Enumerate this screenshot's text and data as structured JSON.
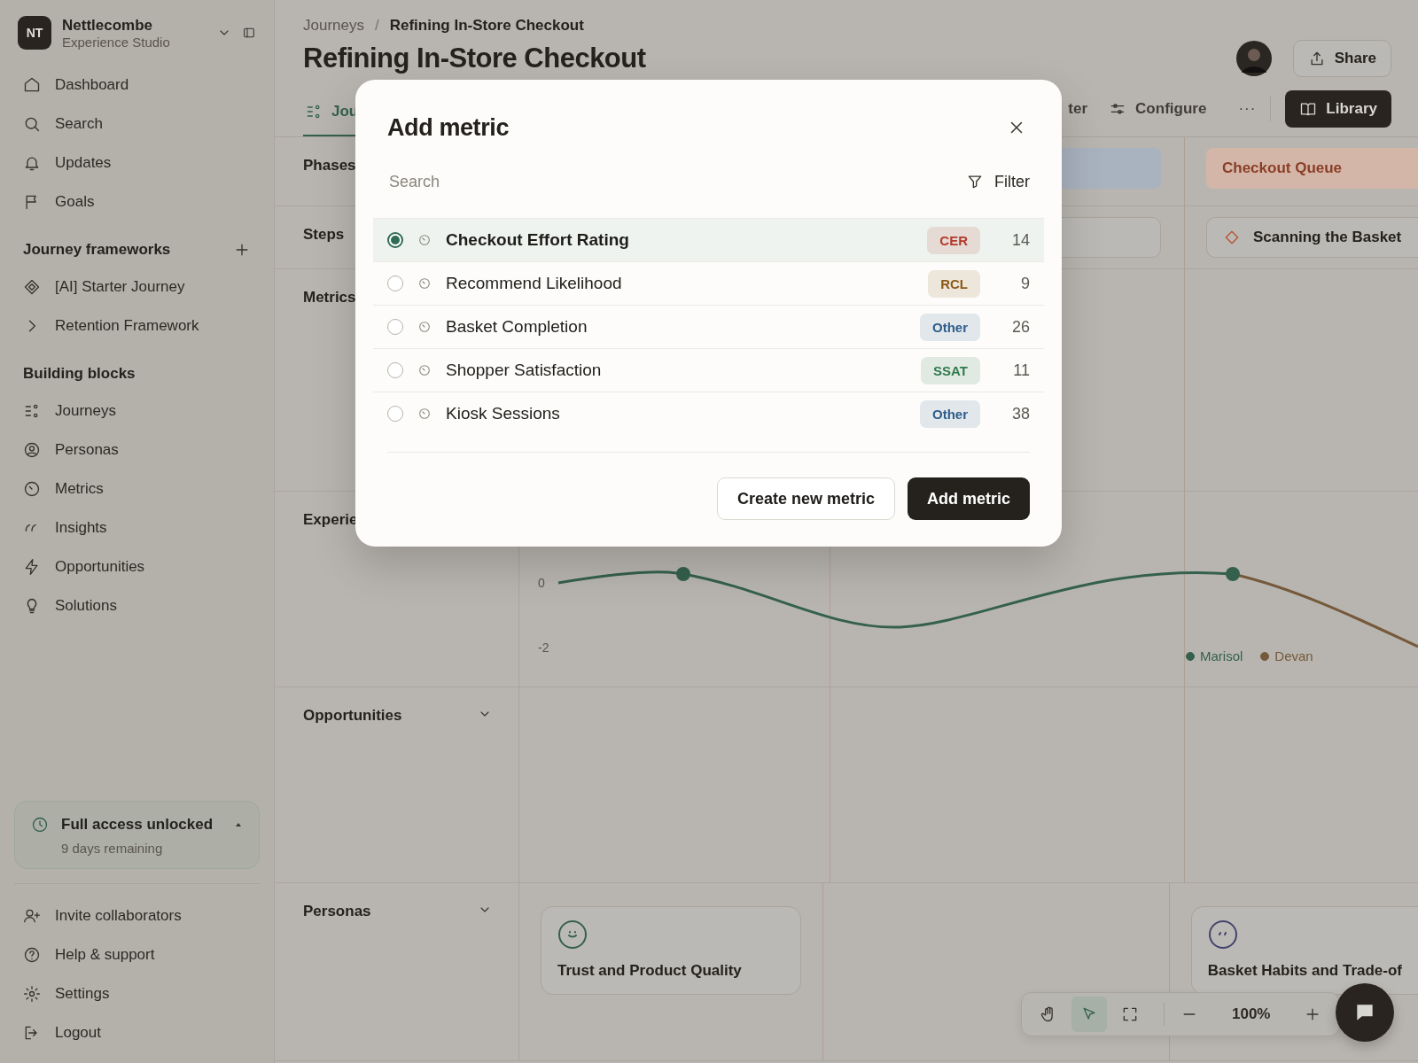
{
  "sidebar": {
    "workspace": {
      "initials": "NT",
      "name": "Nettlecombe",
      "subtitle": "Experience Studio"
    },
    "nav": [
      {
        "label": "Dashboard"
      },
      {
        "label": "Search"
      },
      {
        "label": "Updates"
      },
      {
        "label": "Goals"
      }
    ],
    "frameworks": {
      "title": "Journey frameworks",
      "items": [
        {
          "label": "[AI] Starter Journey"
        },
        {
          "label": "Retention Framework"
        }
      ]
    },
    "building_blocks": {
      "title": "Building blocks",
      "items": [
        {
          "label": "Journeys"
        },
        {
          "label": "Personas"
        },
        {
          "label": "Metrics"
        },
        {
          "label": "Insights"
        },
        {
          "label": "Opportunities"
        },
        {
          "label": "Solutions"
        }
      ]
    },
    "trial": {
      "title": "Full access unlocked",
      "subtitle": "9 days remaining",
      "expanded": true
    },
    "footer": [
      {
        "label": "Invite collaborators"
      },
      {
        "label": "Help & support"
      },
      {
        "label": "Settings"
      },
      {
        "label": "Logout"
      }
    ]
  },
  "header": {
    "breadcrumb": [
      "Journeys",
      "Refining In-Store Checkout"
    ],
    "separator": "/",
    "title": "Refining In-Store Checkout",
    "share": "Share",
    "tabs": [
      {
        "label": "Jou",
        "selected": true
      },
      {
        "label": "ter",
        "selected": false
      },
      {
        "label": "Configure",
        "selected": false
      }
    ],
    "more": "···",
    "library": "Library"
  },
  "canvas": {
    "rows": [
      {
        "label": "Phases",
        "collapsible": false
      },
      {
        "label": "Steps",
        "collapsible": false
      },
      {
        "label": "Metrics",
        "collapsible": false
      },
      {
        "label": "Experie",
        "collapsible": false
      },
      {
        "label": "Opportunities",
        "collapsible": true
      },
      {
        "label": "Personas",
        "collapsible": true
      }
    ],
    "phases": [
      {
        "color": "#a9b2bf"
      },
      {
        "label": "Checkout Queue",
        "color": "#d4b6a9"
      }
    ],
    "steps": [
      {
        "kind": "blank"
      },
      {
        "kind": "step",
        "label": "Scanning the Basket"
      }
    ],
    "experience": {
      "ticks": [
        "0",
        "-2"
      ],
      "legend": [
        {
          "name": "Marisol",
          "color": "#35604e"
        },
        {
          "name": "Devan",
          "color": "#75593a"
        }
      ]
    },
    "personas": [
      {
        "name": "Trust and Product Quality",
        "color": "#35604e"
      },
      {
        "name": "Basket Habits and Trade-of",
        "color": "#43446b"
      }
    ]
  },
  "toolbar": {
    "tools": [
      {
        "selected": false
      },
      {
        "selected": true
      },
      {
        "selected": false
      }
    ],
    "zoom": "100%"
  },
  "modal": {
    "title": "Add metric",
    "search_placeholder": "Search",
    "filter": "Filter",
    "metrics": [
      {
        "name": "Checkout Effort Rating",
        "tag": "CER",
        "color": "#b33a2a",
        "count": "14",
        "selected": true
      },
      {
        "name": "Recommend Likelihood",
        "tag": "RCL",
        "color": "#8a5a16",
        "count": "9",
        "selected": false
      },
      {
        "name": "Basket Completion",
        "tag": "Other",
        "color": "#2e5e8c",
        "count": "26",
        "selected": false
      },
      {
        "name": "Shopper Satisfaction",
        "tag": "SSAT",
        "color": "#2f7a4e",
        "count": "11",
        "selected": false
      },
      {
        "name": "Kiosk Sessions",
        "tag": "Other",
        "color": "#2e5e8c",
        "count": "38",
        "selected": false
      }
    ],
    "secondary": "Create new metric",
    "primary": "Add metric"
  }
}
